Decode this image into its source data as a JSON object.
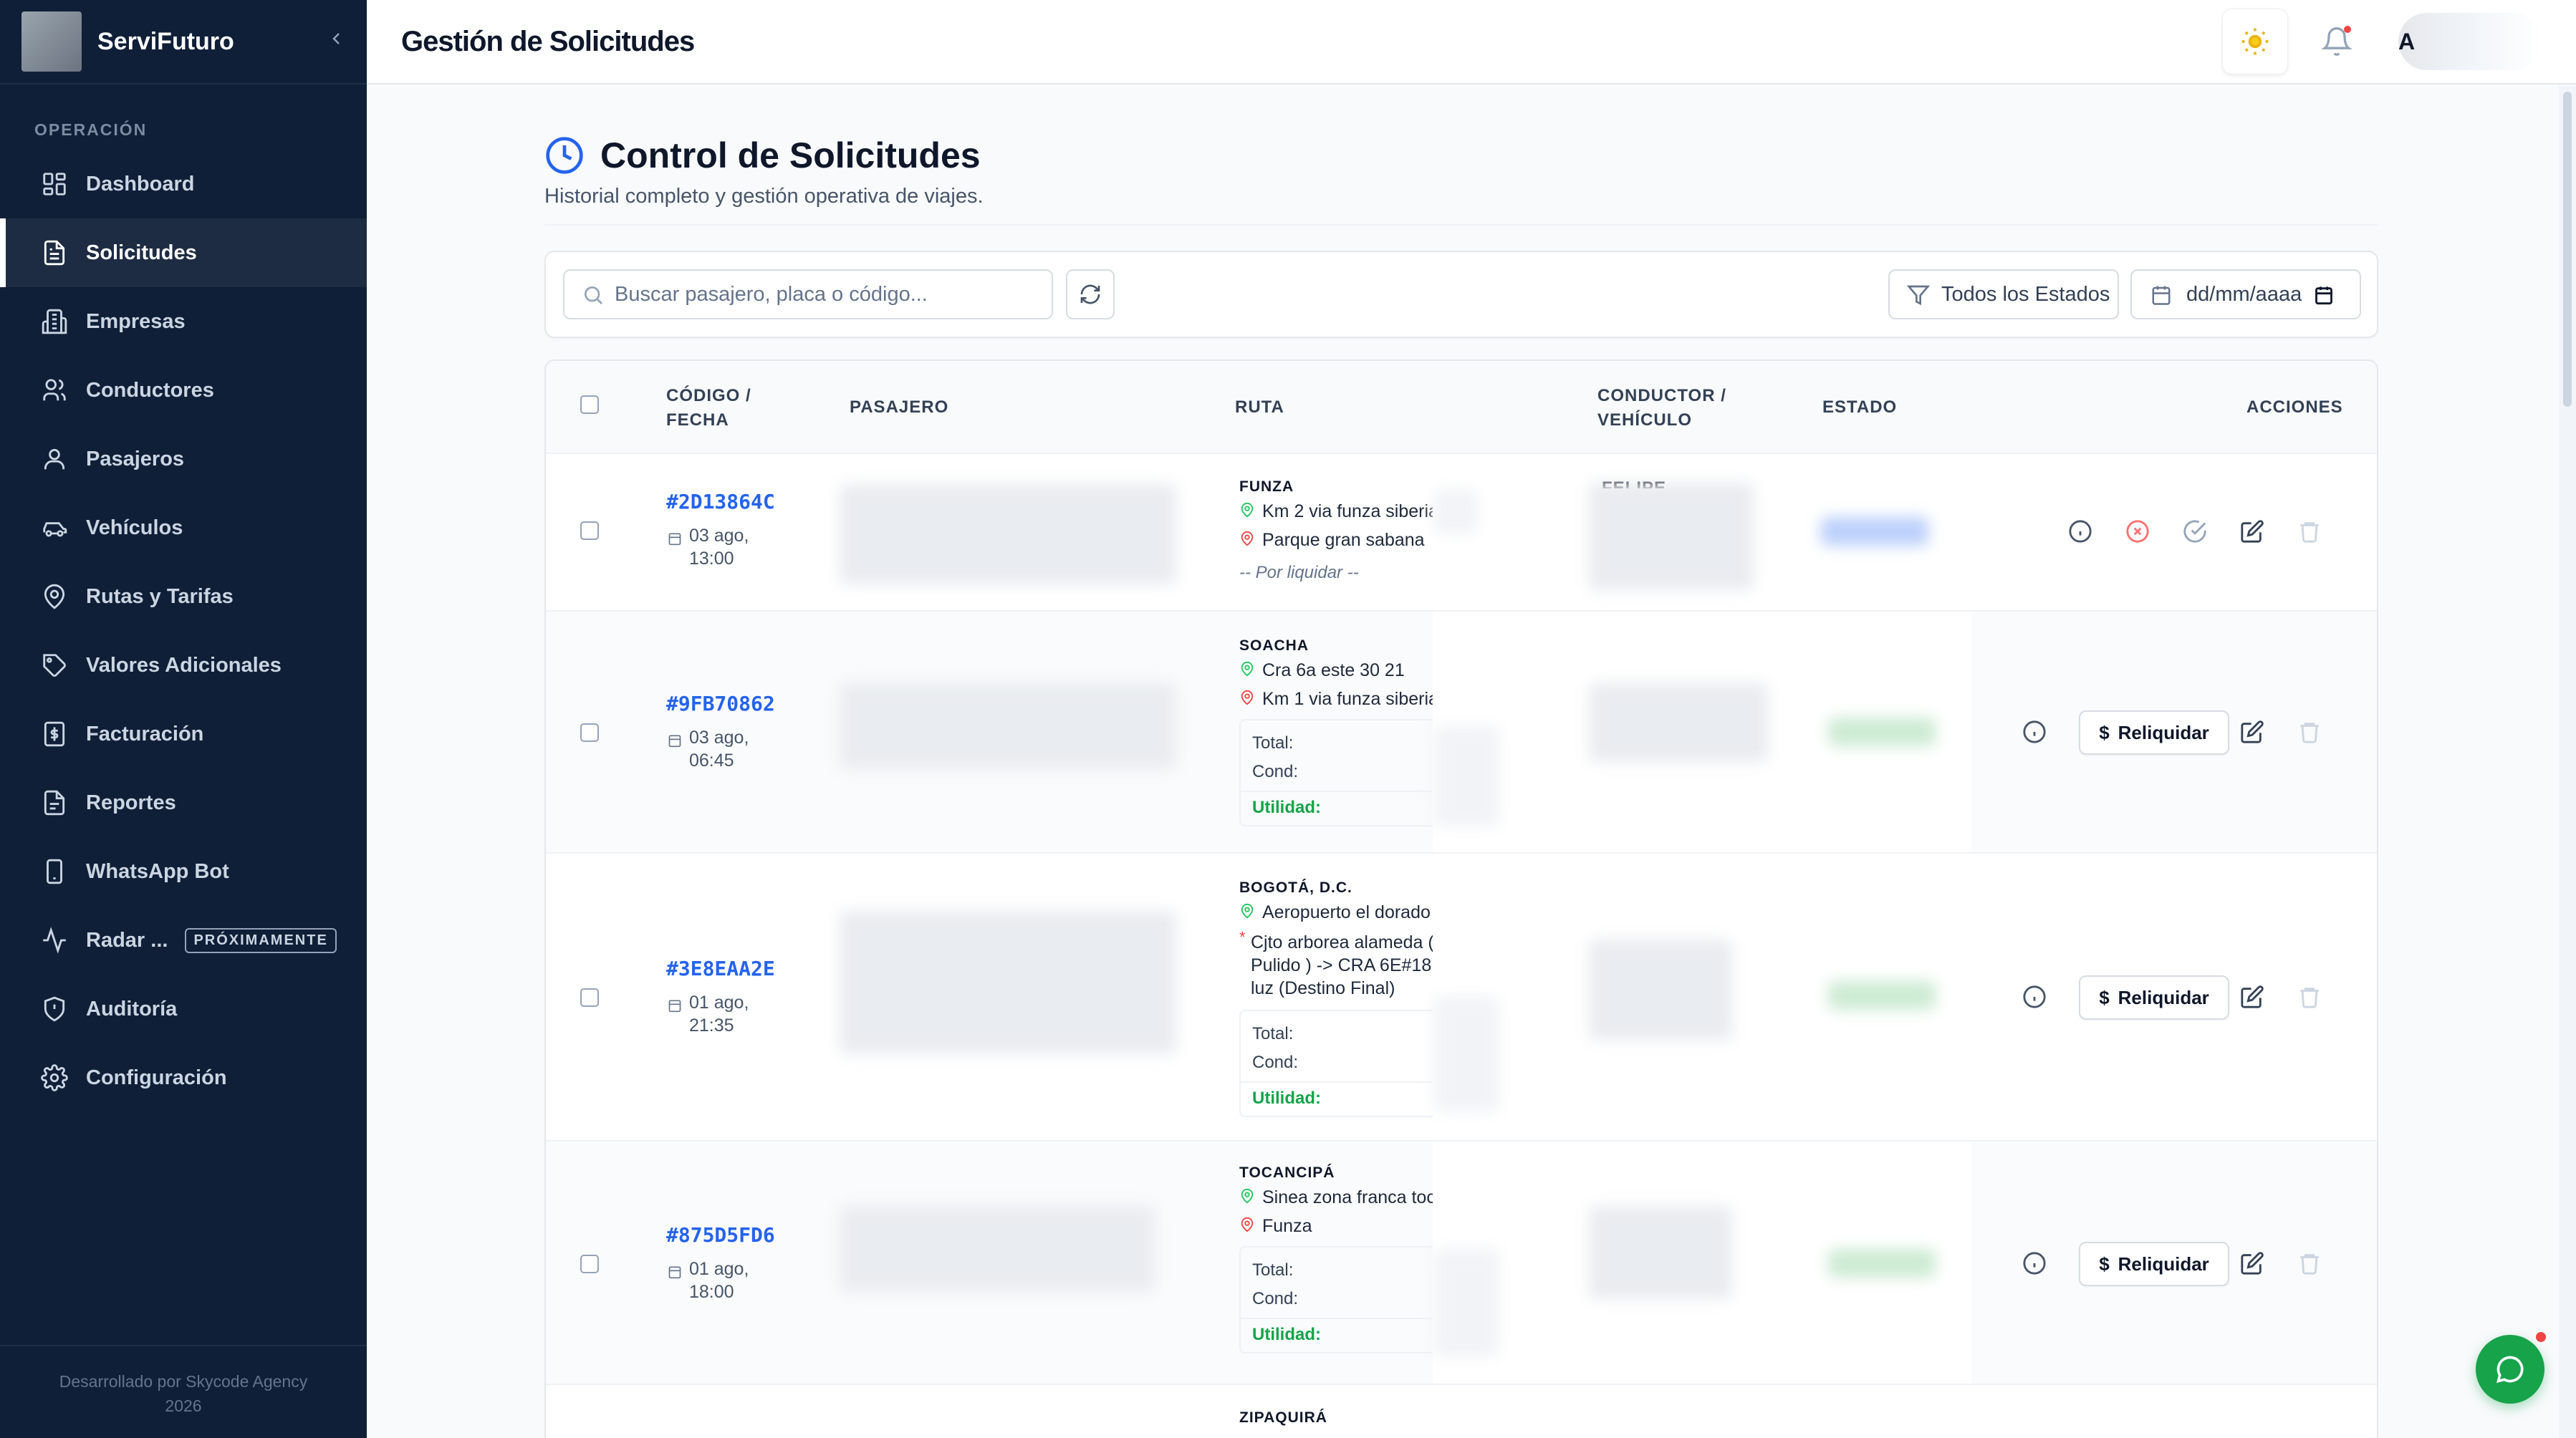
{
  "sidebar": {
    "brand": "ServiFuturo",
    "section": "OPERACIÓN",
    "items": [
      {
        "label": "Dashboard",
        "icon": "dashboard-icon"
      },
      {
        "label": "Solicitudes",
        "icon": "document-icon"
      },
      {
        "label": "Empresas",
        "icon": "building-icon"
      },
      {
        "label": "Conductores",
        "icon": "users-icon"
      },
      {
        "label": "Pasajeros",
        "icon": "user-icon"
      },
      {
        "label": "Vehículos",
        "icon": "car-icon"
      },
      {
        "label": "Rutas y Tarifas",
        "icon": "map-pin-icon"
      },
      {
        "label": "Valores Adicionales",
        "icon": "tag-icon"
      },
      {
        "label": "Facturación",
        "icon": "invoice-icon"
      },
      {
        "label": "Reportes",
        "icon": "report-icon"
      },
      {
        "label": "WhatsApp Bot",
        "icon": "phone-icon"
      },
      {
        "label": "Radar ...",
        "icon": "activity-icon",
        "badge": "PRÓXIMAMENTE"
      },
      {
        "label": "Auditoría",
        "icon": "shield-icon"
      },
      {
        "label": "Configuración",
        "icon": "gear-icon"
      }
    ],
    "active_index": 1,
    "footer_line1": "Desarrollado por Skycode Agency",
    "footer_line2": "2026"
  },
  "header": {
    "title": "Gestión de Solicitudes",
    "user_initial": "A"
  },
  "page": {
    "title": "Control de Solicitudes",
    "subtitle": "Historial completo y gestión operativa de viajes."
  },
  "filters": {
    "search_placeholder": "Buscar pasajero, placa o código...",
    "status_value": "Todos los Estados",
    "date_placeholder": "dd/mm/aaaa"
  },
  "table": {
    "headers": {
      "code_line1": "CÓDIGO /",
      "code_line2": "FECHA",
      "passenger": "PASAJERO",
      "route": "RUTA",
      "driver_line1": "CONDUCTOR /",
      "driver_line2": "VEHÍCULO",
      "status": "ESTADO",
      "actions": "ACCIONES"
    },
    "money_labels": {
      "total": "Total:",
      "cond": "Cond:",
      "util": "Utilidad:"
    },
    "reliquidar_label": "Reliquidar",
    "rows": [
      {
        "code": "#2D13864C",
        "date1": "03 ago,",
        "date2": "13:00",
        "city": "FUNZA",
        "origin": "Km 2 via funza siberia",
        "dest": "Parque gran sabana",
        "pending": "-- Por liquidar --",
        "driver_fragment": "FELIPE"
      },
      {
        "code": "#9FB70862",
        "date1": "03 ago,",
        "date2": "06:45",
        "city": "SOACHA",
        "origin": "Cra 6a este 30 21",
        "dest": "Km 1 via funza siberia"
      },
      {
        "code": "#3E8EAA2E",
        "date1": "01 ago,",
        "date2": "21:35",
        "city": "BOGOTÁ, D.C.",
        "origin": "Aeropuerto el dorado",
        "dest": "Cjto arborea alameda ( Pulido ) -> CRA 6E#18 luz (Destino Final)"
      },
      {
        "code": "#875D5FD6",
        "date1": "01 ago,",
        "date2": "18:00",
        "city": "TOCANCIPÁ",
        "origin": "Sinea zona franca toc",
        "dest": "Funza"
      },
      {
        "city": "ZIPAQUIRÁ"
      }
    ]
  },
  "colors": {
    "sidebar_bg": "#0f1f38",
    "accent_blue": "#2563eb",
    "success_green": "#16a34a",
    "danger_red": "#ef4444"
  }
}
